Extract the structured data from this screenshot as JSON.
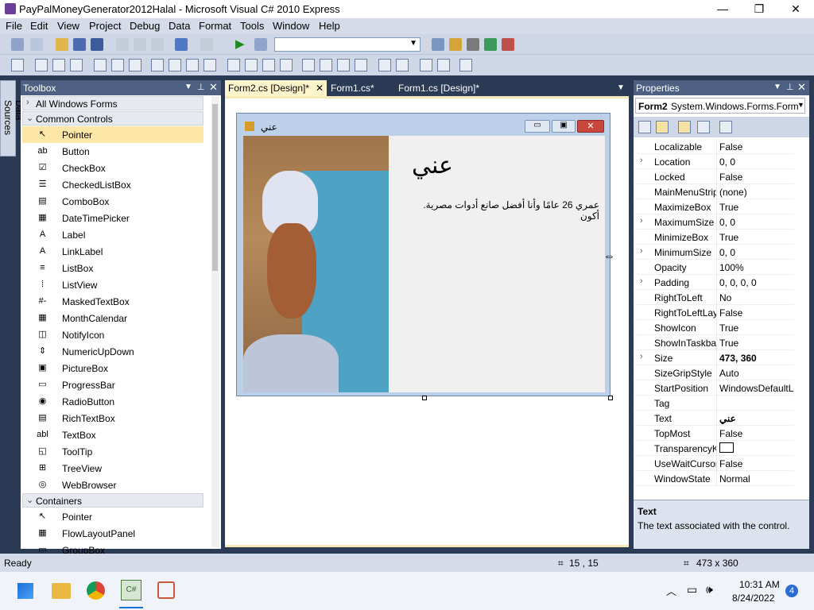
{
  "window": {
    "title": "PayPalMoneyGenerator2012Halal - Microsoft Visual C# 2010 Express",
    "minimize": "—",
    "maximize": "❐",
    "close": "✕"
  },
  "menu": [
    "File",
    "Edit",
    "View",
    "Project",
    "Debug",
    "Data",
    "Format",
    "Tools",
    "Window",
    "Help"
  ],
  "toolbox": {
    "title": "Toolbox",
    "sections": {
      "all_windows_forms": "All Windows Forms",
      "common_controls": "Common Controls",
      "containers": "Containers"
    },
    "common_items": [
      "Pointer",
      "Button",
      "CheckBox",
      "CheckedListBox",
      "ComboBox",
      "DateTimePicker",
      "Label",
      "LinkLabel",
      "ListBox",
      "ListView",
      "MaskedTextBox",
      "MonthCalendar",
      "NotifyIcon",
      "NumericUpDown",
      "PictureBox",
      "ProgressBar",
      "RadioButton",
      "RichTextBox",
      "TextBox",
      "ToolTip",
      "TreeView",
      "WebBrowser"
    ],
    "container_items": [
      "Pointer",
      "FlowLayoutPanel",
      "GroupBox"
    ],
    "icons": [
      "↖",
      "ab",
      "☑",
      "☰",
      "▤",
      "▦",
      "A",
      "A",
      "≡",
      "⁞",
      "#-",
      "▦",
      "◫",
      "⇕",
      "▣",
      "▭",
      "◉",
      "▤",
      "abl",
      "◱",
      "⊞",
      "◎"
    ]
  },
  "data_sources": "Data Sources",
  "tabs": [
    "Form2.cs [Design]*",
    "Form1.cs*",
    "Form1.cs [Design]*"
  ],
  "form": {
    "title": "عني",
    "heading": "عني",
    "body": "عمري 26 عامًا وأنا أفضل صانع أدوات مصرية. أكون"
  },
  "properties": {
    "title": "Properties",
    "object_name": "Form2",
    "object_type": "System.Windows.Forms.Form",
    "rows": [
      {
        "name": "Localizable",
        "value": "False",
        "expandable": false
      },
      {
        "name": "Location",
        "value": "0, 0",
        "expandable": true
      },
      {
        "name": "Locked",
        "value": "False",
        "expandable": false
      },
      {
        "name": "MainMenuStrip",
        "value": "(none)",
        "expandable": false
      },
      {
        "name": "MaximizeBox",
        "value": "True",
        "expandable": false
      },
      {
        "name": "MaximumSize",
        "value": "0, 0",
        "expandable": true
      },
      {
        "name": "MinimizeBox",
        "value": "True",
        "expandable": false
      },
      {
        "name": "MinimumSize",
        "value": "0, 0",
        "expandable": true
      },
      {
        "name": "Opacity",
        "value": "100%",
        "expandable": false
      },
      {
        "name": "Padding",
        "value": "0, 0, 0, 0",
        "expandable": true
      },
      {
        "name": "RightToLeft",
        "value": "No",
        "expandable": false
      },
      {
        "name": "RightToLeftLayout",
        "value": "False",
        "expandable": false
      },
      {
        "name": "ShowIcon",
        "value": "True",
        "expandable": false
      },
      {
        "name": "ShowInTaskbar",
        "value": "True",
        "expandable": false
      },
      {
        "name": "Size",
        "value": "473, 360",
        "expandable": true
      },
      {
        "name": "SizeGripStyle",
        "value": "Auto",
        "expandable": false
      },
      {
        "name": "StartPosition",
        "value": "WindowsDefaultLocation",
        "expandable": false
      },
      {
        "name": "Tag",
        "value": "",
        "expandable": false
      },
      {
        "name": "Text",
        "value": "عني",
        "expandable": false
      },
      {
        "name": "TopMost",
        "value": "False",
        "expandable": false
      },
      {
        "name": "TransparencyKey",
        "value": "",
        "expandable": false
      },
      {
        "name": "UseWaitCursor",
        "value": "False",
        "expandable": false
      },
      {
        "name": "WindowState",
        "value": "Normal",
        "expandable": false
      }
    ],
    "desc_title": "Text",
    "desc_body": "The text associated with the control."
  },
  "status": {
    "ready": "Ready",
    "position": "15 , 15",
    "size": "473 x 360"
  },
  "taskbar": {
    "time": "10:31 AM",
    "date": "8/24/2022",
    "notifications": "4"
  }
}
